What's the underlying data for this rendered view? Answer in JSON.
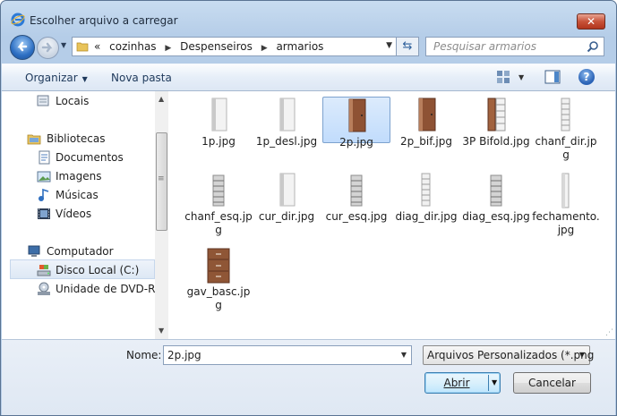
{
  "window": {
    "title": "Escolher arquivo a carregar",
    "close_label": "✕"
  },
  "address": {
    "overflow": "«",
    "crumbs": [
      "cozinhas",
      "Despenseiros",
      "armarios"
    ]
  },
  "search": {
    "placeholder": "Pesquisar armarios"
  },
  "toolbar": {
    "organize_label": "Organizar",
    "new_folder_label": "Nova pasta",
    "help_label": "?"
  },
  "nav_pane": {
    "items": [
      {
        "label": "Locais",
        "icon": "recent-places-icon"
      },
      {
        "label": "Bibliotecas",
        "icon": "libraries-icon"
      },
      {
        "label": "Documentos",
        "icon": "documents-icon"
      },
      {
        "label": "Imagens",
        "icon": "pictures-icon"
      },
      {
        "label": "Músicas",
        "icon": "music-icon"
      },
      {
        "label": "Vídeos",
        "icon": "videos-icon"
      },
      {
        "label": "Computador",
        "icon": "computer-icon"
      },
      {
        "label": "Disco Local (C:)",
        "icon": "local-disk-icon",
        "selected": true
      },
      {
        "label": "Unidade de DVD-RW",
        "icon": "dvd-drive-icon"
      }
    ]
  },
  "files": [
    {
      "name": "1p.jpg",
      "kind": "white-cabinet"
    },
    {
      "name": "1p_desl.jpg",
      "kind": "white-cabinet"
    },
    {
      "name": "2p.jpg",
      "kind": "wood-cabinet",
      "selected": true
    },
    {
      "name": "2p_bif.jpg",
      "kind": "wood-cabinet"
    },
    {
      "name": "3P Bifold.jpg",
      "kind": "shelf-open"
    },
    {
      "name": "chanf_dir.jpg",
      "kind": "white-shelf"
    },
    {
      "name": "chanf_esq.jpg",
      "kind": "grey-shelf"
    },
    {
      "name": "cur_dir.jpg",
      "kind": "white-cabinet"
    },
    {
      "name": "cur_esq.jpg",
      "kind": "grey-shelf"
    },
    {
      "name": "diag_dir.jpg",
      "kind": "white-shelf"
    },
    {
      "name": "diag_esq.jpg",
      "kind": "grey-shelf"
    },
    {
      "name": "fechamento.jpg",
      "kind": "white-panel"
    },
    {
      "name": "gav_basc.jpg",
      "kind": "wood-drawers"
    }
  ],
  "bottom": {
    "name_label": "Nome:",
    "name_value": "2p.jpg",
    "filter_value": "Arquivos Personalizados (*.png",
    "open_label": "Abrir",
    "cancel_label": "Cancelar"
  }
}
